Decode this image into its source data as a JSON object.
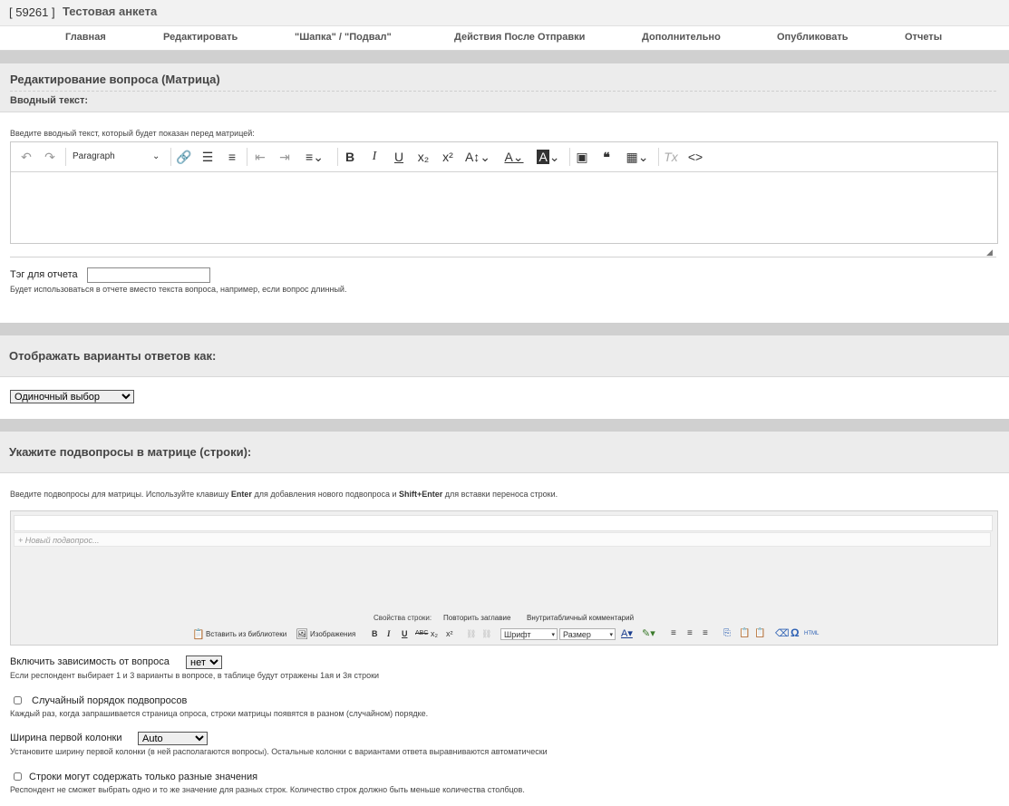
{
  "header": {
    "survey_id": "[ 59261 ]",
    "survey_title": "Тестовая анкета"
  },
  "nav": [
    {
      "label": "Главная"
    },
    {
      "label": "Редактировать"
    },
    {
      "label": "\"Шапка\" / \"Подвал\""
    },
    {
      "label": "Действия После Отправки"
    },
    {
      "label": "Дополнительно"
    },
    {
      "label": "Опубликовать"
    },
    {
      "label": "Отчеты"
    }
  ],
  "section1": {
    "title": "Редактирование вопроса (Матрица)",
    "intro_label": "Вводный текст:",
    "intro_hint": "Введите вводный текст, который будет показан перед матрицей:",
    "toolbar": {
      "paragraph": "Paragraph",
      "icons": [
        "undo-icon",
        "redo-icon",
        "link-icon",
        "bullet-list-icon",
        "numbered-list-icon",
        "outdent-icon",
        "indent-icon",
        "align-icon",
        "bold-icon",
        "italic-icon",
        "underline-icon",
        "subscript-icon",
        "superscript-icon",
        "font-size-icon",
        "text-color-icon",
        "highlight-icon",
        "image-icon",
        "quote-icon",
        "table-icon",
        "clear-format-icon",
        "source-code-icon"
      ]
    },
    "tag_label": "Тэг для отчета",
    "tag_value": "",
    "tag_hint": "Будет использоваться в отчете вместо текста вопроса, например, если вопрос длинный."
  },
  "section2": {
    "title": "Отображать варианты ответов как:",
    "select_value": "Одиночный выбор"
  },
  "section3": {
    "title": "Укажите подвопросы в матрице (строки):",
    "hint_pre": "Введите подвопросы для матрицы. Используйте клавишу ",
    "hint_key1": "Enter",
    "hint_mid": " для добавления нового подвопроса и ",
    "hint_key2": "Shift+Enter",
    "hint_post": " для вставки переноса строки.",
    "new_row_placeholder": "Новый подвопрос...",
    "row_props_label": "Свойства строки:",
    "row_props_repeat": "Повторить заглавие",
    "row_props_comment": "Внутритабличный комментарий",
    "insert_library": "Вставить из библиотеки",
    "images": "Изображения",
    "font_label": "Шрифт",
    "size_label": "Размер",
    "html_label": "HTML"
  },
  "dependency": {
    "label": "Включить зависимость от вопроса",
    "value": "нет",
    "hint": "Если респондент выбирает 1 и 3 варианты в вопросе, в таблице будут отражены 1ая и 3я строки"
  },
  "random_order": {
    "label": "Случайный порядок подвопросов",
    "checked": false,
    "hint": "Каждый раз, когда запрашивается страница опроса, строки матрицы появятся в разном (случайном) порядке."
  },
  "first_col_width": {
    "label": "Ширина первой колонки",
    "value": "Auto",
    "hint": "Установите ширину первой колонки (в ней располагаются вопросы). Остальные колонки с вариантами ответа выравниваются автоматически"
  },
  "unique_rows": {
    "label": "Строки могут содержать только разные значения",
    "checked": false,
    "hint": "Респондент не сможет выбрать одно и то же значение для разных строк. Количество строк должно быть меньше количества столбцов."
  }
}
